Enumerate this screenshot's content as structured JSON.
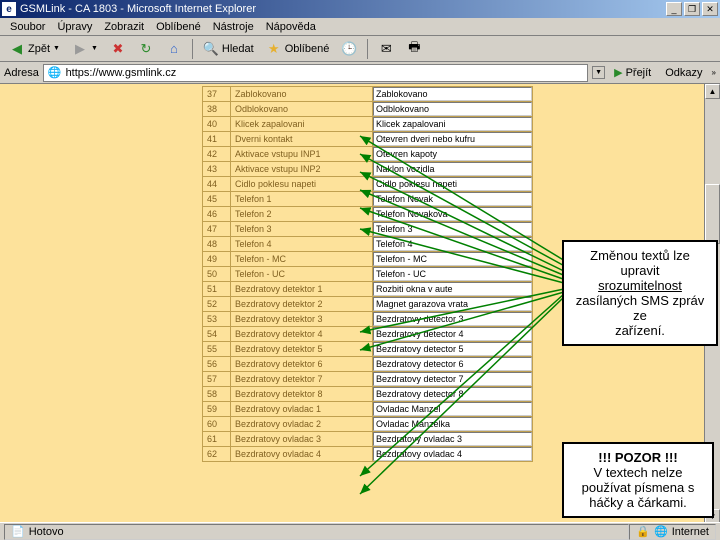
{
  "window": {
    "title": "GSMLink - CA 1803 - Microsoft Internet Explorer"
  },
  "menu": {
    "soubor": "Soubor",
    "upravy": "Úpravy",
    "zobrazit": "Zobrazit",
    "oblibene": "Oblíbené",
    "nastroje": "Nástroje",
    "napoveda": "Nápověda"
  },
  "toolbar": {
    "back": "Zpět",
    "search": "Hledat",
    "favorites": "Oblíbené"
  },
  "address": {
    "label": "Adresa",
    "url": "https://www.gsmlink.cz",
    "go": "Přejít",
    "links": "Odkazy"
  },
  "rows": [
    {
      "n": "37",
      "d": "Zablokovano",
      "v": "Zablokovano"
    },
    {
      "n": "38",
      "d": "Odblokovano",
      "v": "Odblokovano"
    },
    {
      "n": "40",
      "d": "Klicek zapalovani",
      "v": "Klicek zapalovani"
    },
    {
      "n": "41",
      "d": "Dverni kontakt",
      "v": "Otevren dveri nebo kufru"
    },
    {
      "n": "42",
      "d": "Aktivace vstupu INP1",
      "v": "Otevren kapoty"
    },
    {
      "n": "43",
      "d": "Aktivace vstupu INP2",
      "v": "Naklon vozidla"
    },
    {
      "n": "44",
      "d": "Cidlo poklesu napeti",
      "v": "Cidlo poklesu napeti"
    },
    {
      "n": "45",
      "d": "Telefon 1",
      "v": "Telefon Novak"
    },
    {
      "n": "46",
      "d": "Telefon 2",
      "v": "Telefon Novakova"
    },
    {
      "n": "47",
      "d": "Telefon 3",
      "v": "Telefon 3"
    },
    {
      "n": "48",
      "d": "Telefon 4",
      "v": "Telefon 4"
    },
    {
      "n": "49",
      "d": "Telefon - MC",
      "v": "Telefon - MC"
    },
    {
      "n": "50",
      "d": "Telefon - UC",
      "v": "Telefon - UC"
    },
    {
      "n": "51",
      "d": "Bezdratovy detektor 1",
      "v": "Rozbiti okna v aute"
    },
    {
      "n": "52",
      "d": "Bezdratovy detektor 2",
      "v": "Magnet garazova vrata"
    },
    {
      "n": "53",
      "d": "Bezdratovy detektor 3",
      "v": "Bezdratovy detector 3"
    },
    {
      "n": "54",
      "d": "Bezdratovy detektor 4",
      "v": "Bezdratovy detector 4"
    },
    {
      "n": "55",
      "d": "Bezdratovy detektor 5",
      "v": "Bezdratovy detector 5"
    },
    {
      "n": "56",
      "d": "Bezdratovy detektor 6",
      "v": "Bezdratovy detector 6"
    },
    {
      "n": "57",
      "d": "Bezdratovy detektor 7",
      "v": "Bezdratovy detector 7"
    },
    {
      "n": "58",
      "d": "Bezdratovy detektor 8",
      "v": "Bezdratovy detector 8"
    },
    {
      "n": "59",
      "d": "Bezdratovy ovladac 1",
      "v": "Ovladac Manzel"
    },
    {
      "n": "60",
      "d": "Bezdratovy ovladac 2",
      "v": "Ovladac Manzelka"
    },
    {
      "n": "61",
      "d": "Bezdratovy ovladac 3",
      "v": "Bezdratovy ovladac 3"
    },
    {
      "n": "62",
      "d": "Bezdratovy ovladac 4",
      "v": "Bezdratovy ovladac 4"
    }
  ],
  "callout1": {
    "line1": "Změnou textů lze upravit",
    "line2": "srozumitelnost",
    "line3": "zasílaných SMS zpráv ze",
    "line4": "zařízení."
  },
  "callout2": {
    "title": "!!! POZOR !!!",
    "line1": "V textech nelze",
    "line2": "používat písmena s",
    "line3": "háčky a čárkami."
  },
  "status": {
    "done": "Hotovo",
    "zone": "Internet"
  }
}
